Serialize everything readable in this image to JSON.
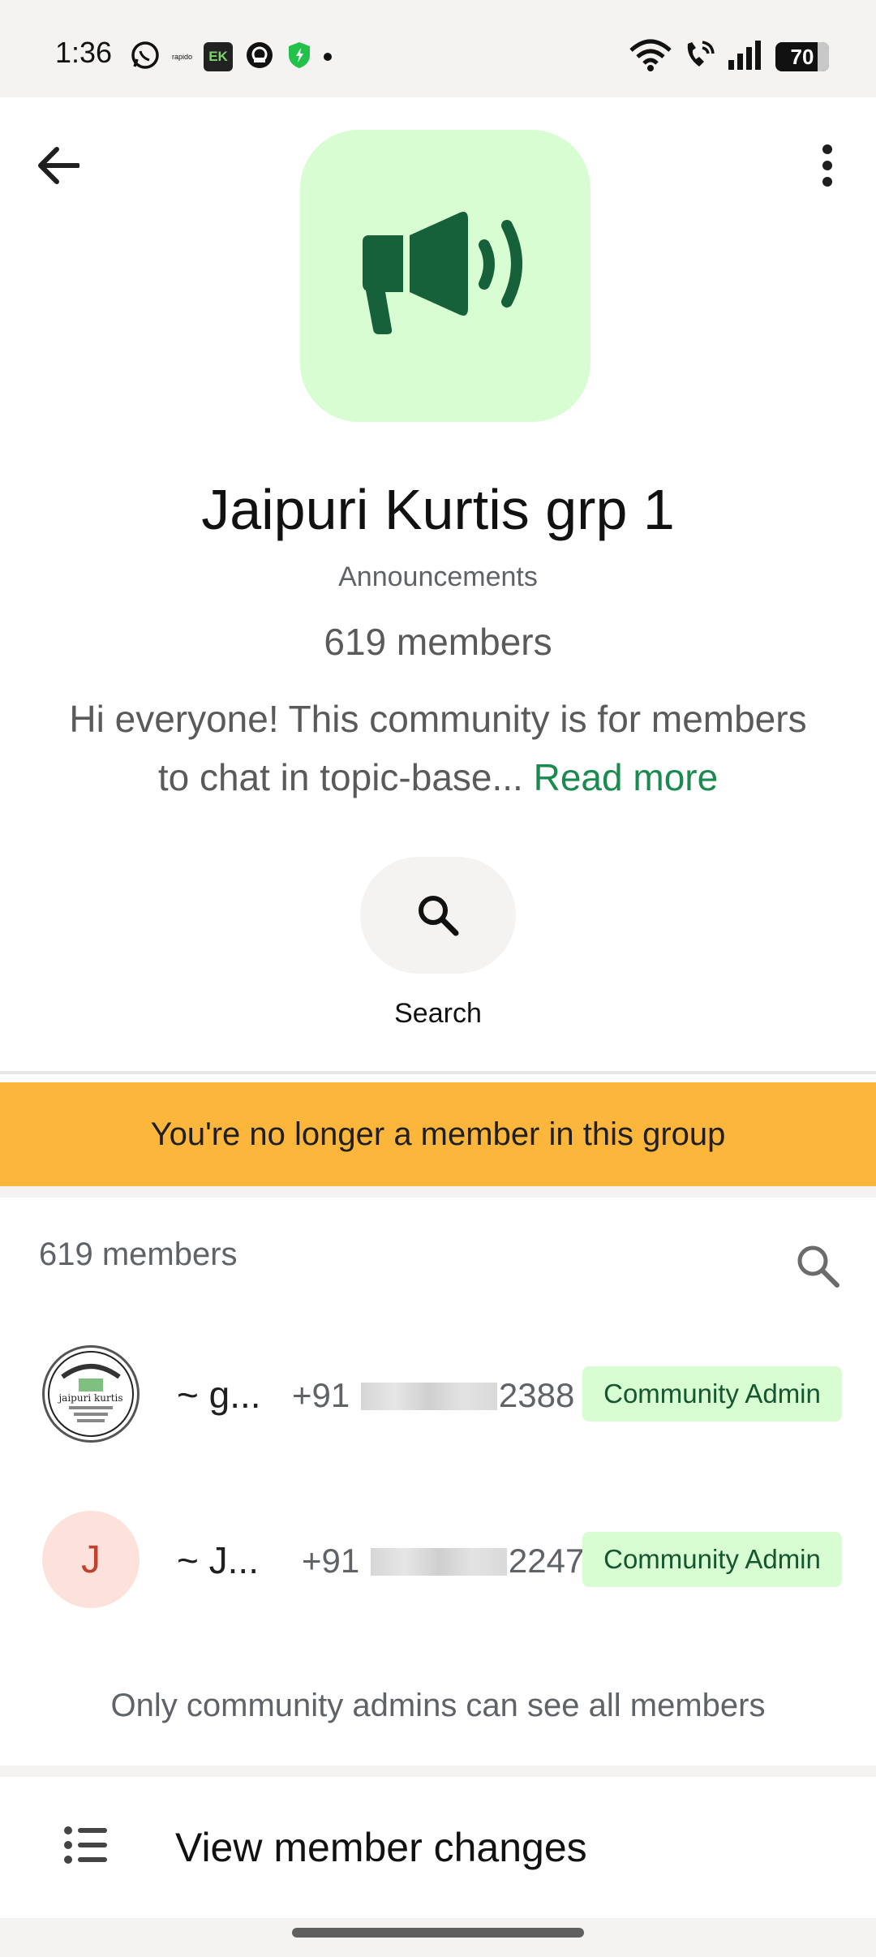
{
  "status_bar": {
    "time": "1:36",
    "left_icons": [
      "whatsapp-icon",
      "rapido-icon",
      "ek-app-icon",
      "chat-app-icon",
      "shield-icon",
      "dot-icon"
    ],
    "rapido_text": "rapido",
    "ek_text": "EK",
    "right_icons": [
      "wifi-icon",
      "wifi-calling-icon",
      "signal-icon",
      "battery-icon"
    ],
    "battery_level": "70"
  },
  "header": {
    "back_icon": "arrow-back-icon",
    "more_icon": "more-vertical-icon"
  },
  "group": {
    "avatar_icon": "megaphone-icon",
    "avatar_bg": "#d9fdd3",
    "avatar_fg": "#16603a",
    "title": "Jaipuri Kurtis grp 1",
    "subtitle": "Announcements",
    "member_count": "619 members",
    "description": "Hi everyone! This community is for members to chat in topic-base...",
    "read_more": "Read more"
  },
  "search_action": {
    "icon": "search-icon",
    "label": "Search"
  },
  "notice": {
    "text": "You're no longer a member in this group",
    "color": "#fcb63b"
  },
  "members": {
    "header": "619 members",
    "search_icon": "search-icon",
    "list": [
      {
        "name": "~ g...",
        "phone_prefix": "+91",
        "phone_suffix": "2388",
        "role": "Community Admin",
        "avatar_type": "logo",
        "avatar_text": "jaipuri kurtis"
      },
      {
        "name": "~ J...",
        "phone_prefix": "+91",
        "phone_suffix": "2247",
        "role": "Community Admin",
        "avatar_type": "letter",
        "avatar_letter": "J"
      }
    ],
    "note": "Only community admins can see all members"
  },
  "view_changes": {
    "icon": "list-icon",
    "label": "View member changes"
  },
  "colors": {
    "accent_green": "#1a8a4e",
    "badge_bg": "#d9fdd3",
    "badge_fg": "#14572f"
  }
}
